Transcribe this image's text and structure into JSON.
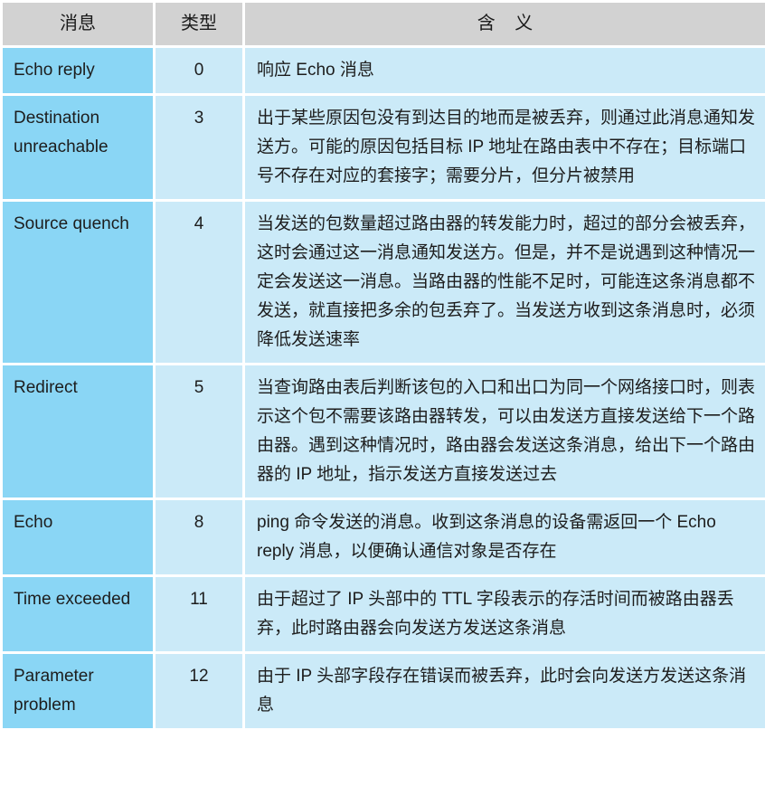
{
  "table": {
    "headers": {
      "message": "消息",
      "type": "类型",
      "meaning": "含 义"
    },
    "rows": [
      {
        "message": "Echo reply",
        "type": "0",
        "meaning": "响应 Echo 消息"
      },
      {
        "message": "Destination unreachable",
        "type": "3",
        "meaning": "出于某些原因包没有到达目的地而是被丢弃，则通过此消息通知发送方。可能的原因包括目标 IP 地址在路由表中不存在；目标端口号不存在对应的套接字；需要分片，但分片被禁用"
      },
      {
        "message": "Source quench",
        "type": "4",
        "meaning": "当发送的包数量超过路由器的转发能力时，超过的部分会被丢弃，这时会通过这一消息通知发送方。但是，并不是说遇到这种情况一定会发送这一消息。当路由器的性能不足时，可能连这条消息都不发送，就直接把多余的包丢弃了。当发送方收到这条消息时，必须降低发送速率"
      },
      {
        "message": "Redirect",
        "type": "5",
        "meaning": "当查询路由表后判断该包的入口和出口为同一个网络接口时，则表示这个包不需要该路由器转发，可以由发送方直接发送给下一个路由器。遇到这种情况时，路由器会发送这条消息，给出下一个路由器的 IP 地址，指示发送方直接发送过去"
      },
      {
        "message": "Echo",
        "type": "8",
        "meaning": "ping 命令发送的消息。收到这条消息的设备需返回一个 Echo reply 消息，以便确认通信对象是否存在"
      },
      {
        "message": "Time exceeded",
        "type": "11",
        "meaning": "由于超过了 IP 头部中的 TTL 字段表示的存活时间而被路由器丢弃，此时路由器会向发送方发送这条消息"
      },
      {
        "message": "Parameter problem",
        "type": "12",
        "meaning": "由于 IP 头部字段存在错误而被丢弃，此时会向发送方发送这条消息"
      }
    ]
  },
  "colors": {
    "header_background": "#d2d2d2",
    "message_cell_background": "#8ad6f5",
    "detail_cell_background": "#cbeaf8",
    "gap": "#ffffff",
    "text": "#1d1d1d"
  }
}
